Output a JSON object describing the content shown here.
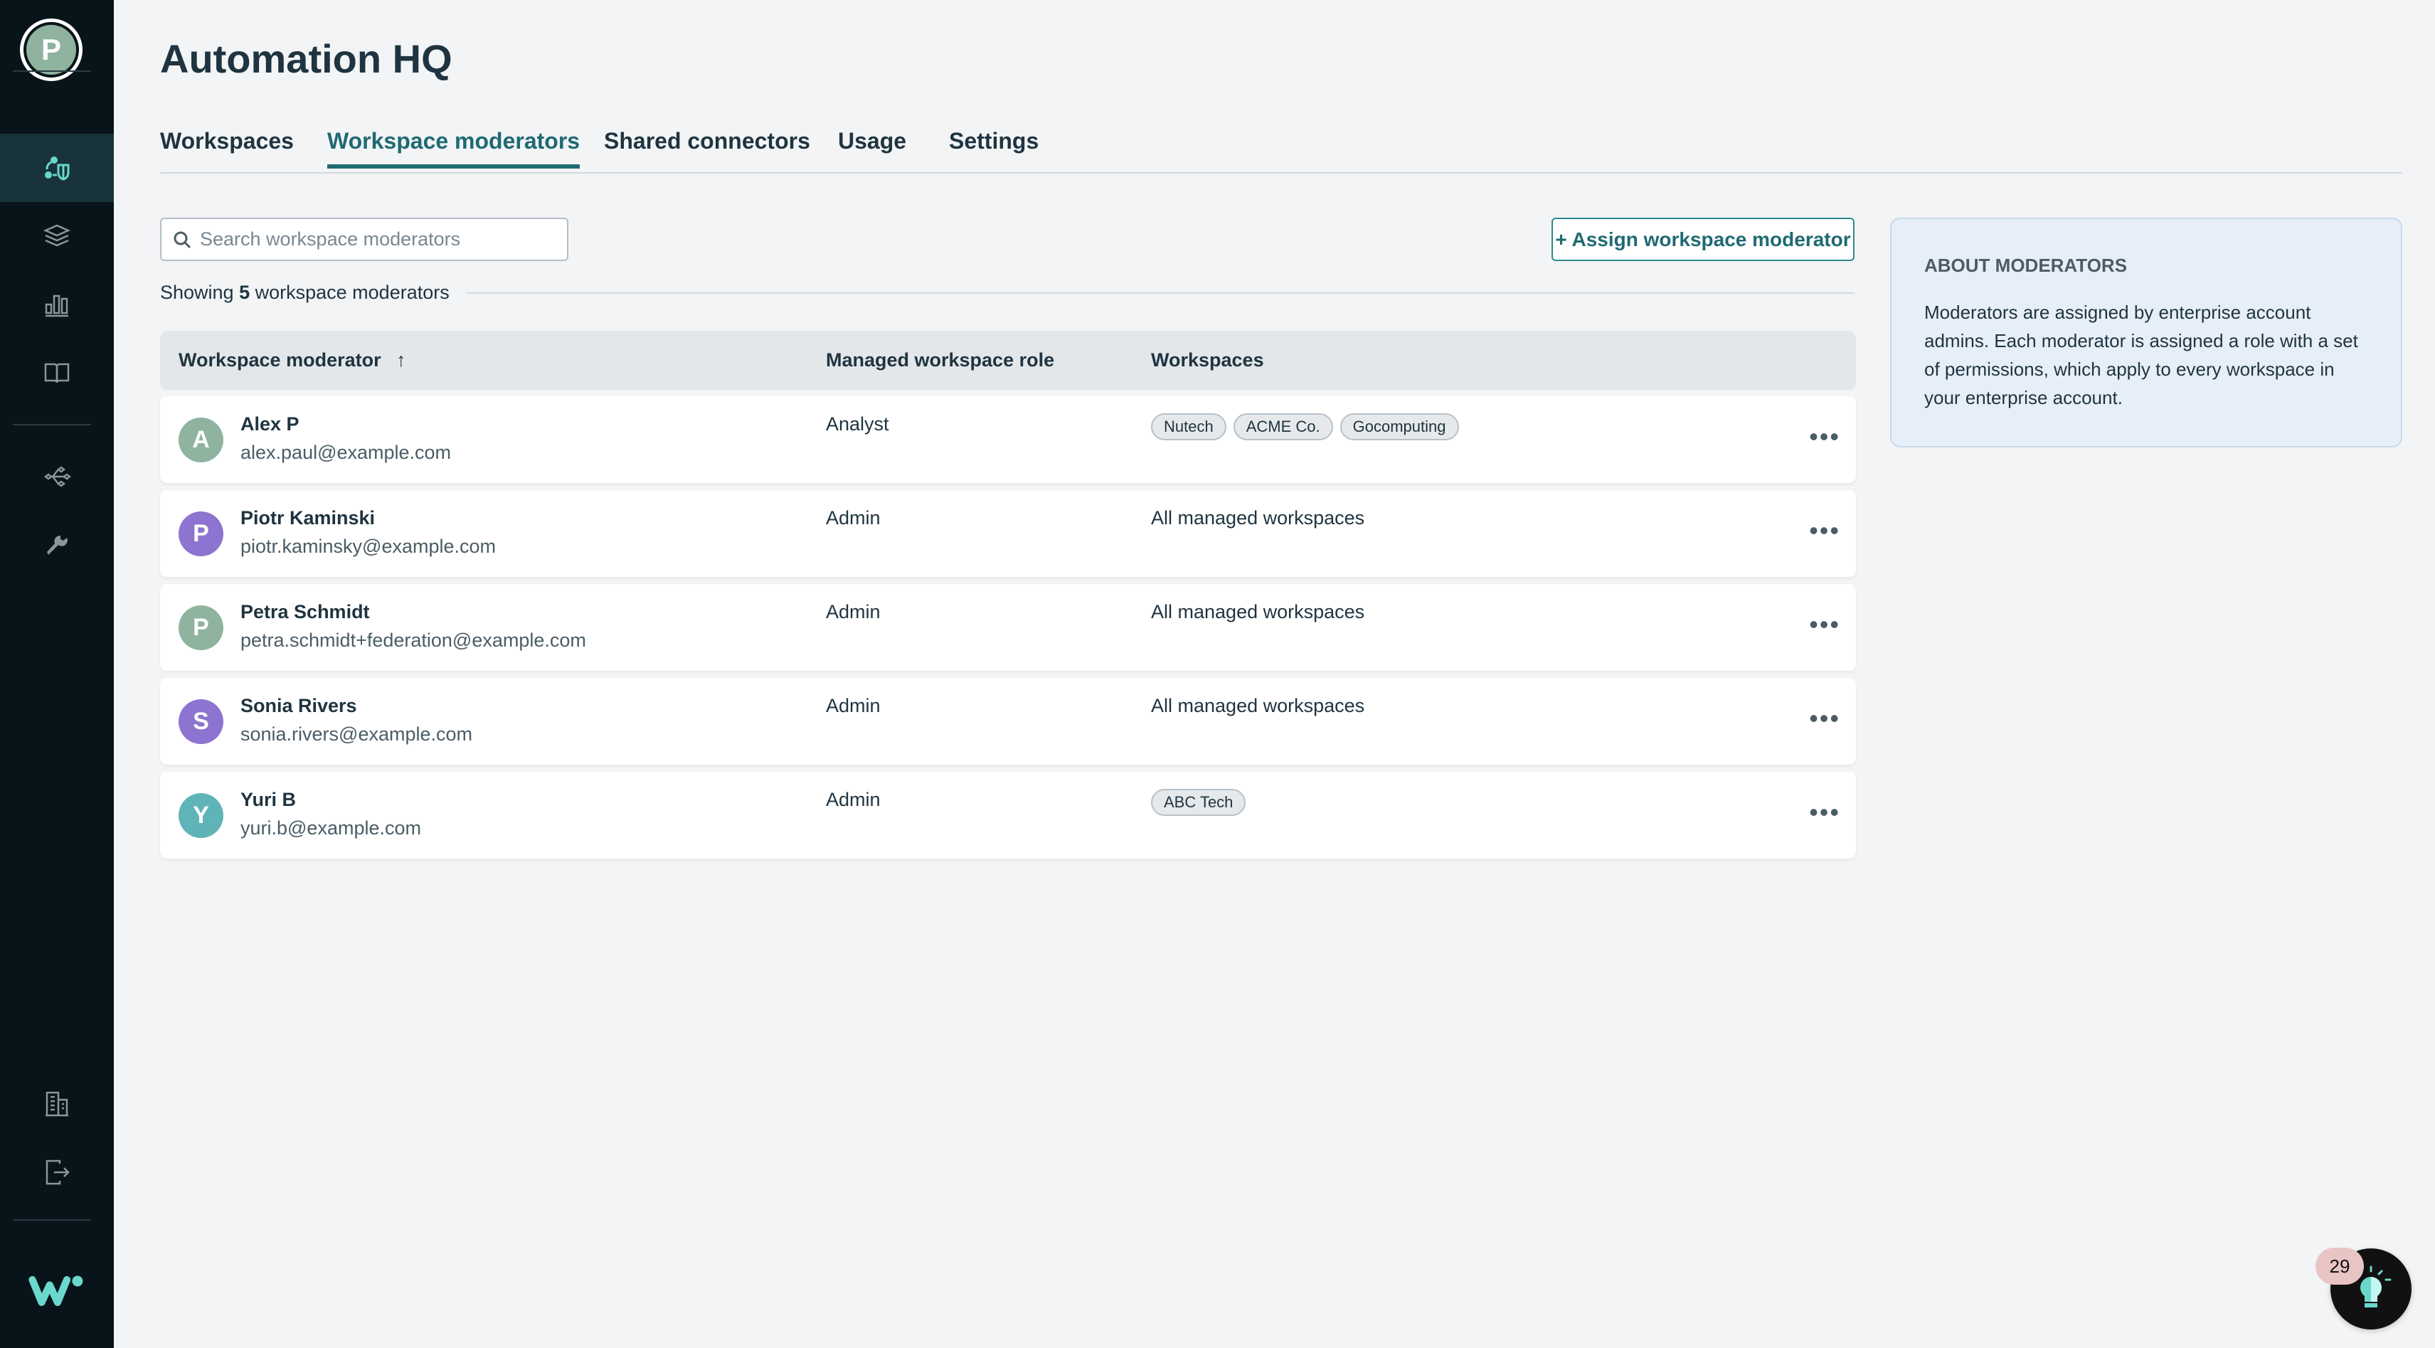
{
  "sidebar": {
    "user_initial": "P",
    "avatar_color": "#8fb39e",
    "active_color": "#6ad8cc"
  },
  "header": {
    "title": "Automation HQ"
  },
  "tabs": [
    {
      "label": "Workspaces"
    },
    {
      "label": "Workspace moderators",
      "active": true
    },
    {
      "label": "Shared connectors"
    },
    {
      "label": "Usage"
    },
    {
      "label": "Settings"
    }
  ],
  "toolbar": {
    "search_placeholder": "Search workspace moderators",
    "assign_label": "+ Assign workspace moderator"
  },
  "summary": {
    "prefix": "Showing ",
    "count": "5",
    "suffix": " workspace moderators"
  },
  "table": {
    "headers": [
      "Workspace moderator",
      "Managed workspace role",
      "Workspaces"
    ],
    "sort_icon": "arrow-up",
    "rows": [
      {
        "initial": "A",
        "color": "#8fb39e",
        "name": "Alex P",
        "email": "alex.paul@example.com",
        "role": "Analyst",
        "workspaces": [
          "Nutech",
          "ACME Co.",
          "Gocomputing"
        ]
      },
      {
        "initial": "P",
        "color": "#8d74d0",
        "name": "Piotr Kaminski",
        "email": "piotr.kaminsky@example.com",
        "role": "Admin",
        "workspaces_text": "All managed workspaces"
      },
      {
        "initial": "P",
        "color": "#8fb39e",
        "name": "Petra Schmidt",
        "email": "petra.schmidt+federation@example.com",
        "role": "Admin",
        "workspaces_text": "All managed workspaces"
      },
      {
        "initial": "S",
        "color": "#8d74d0",
        "name": "Sonia Rivers",
        "email": "sonia.rivers@example.com",
        "role": "Admin",
        "workspaces_text": "All managed workspaces"
      },
      {
        "initial": "Y",
        "color": "#5fb4b8",
        "name": "Yuri B",
        "email": "yuri.b@example.com",
        "role": "Admin",
        "workspaces": [
          "ABC Tech"
        ]
      }
    ],
    "more_label": "•••"
  },
  "about": {
    "title": "ABOUT MODERATORS",
    "body": "Moderators are assigned by enterprise account admins. Each moderator is assigned a role with a set of permissions, which apply to every workspace in your enterprise account."
  },
  "notifications": {
    "count": "29"
  }
}
